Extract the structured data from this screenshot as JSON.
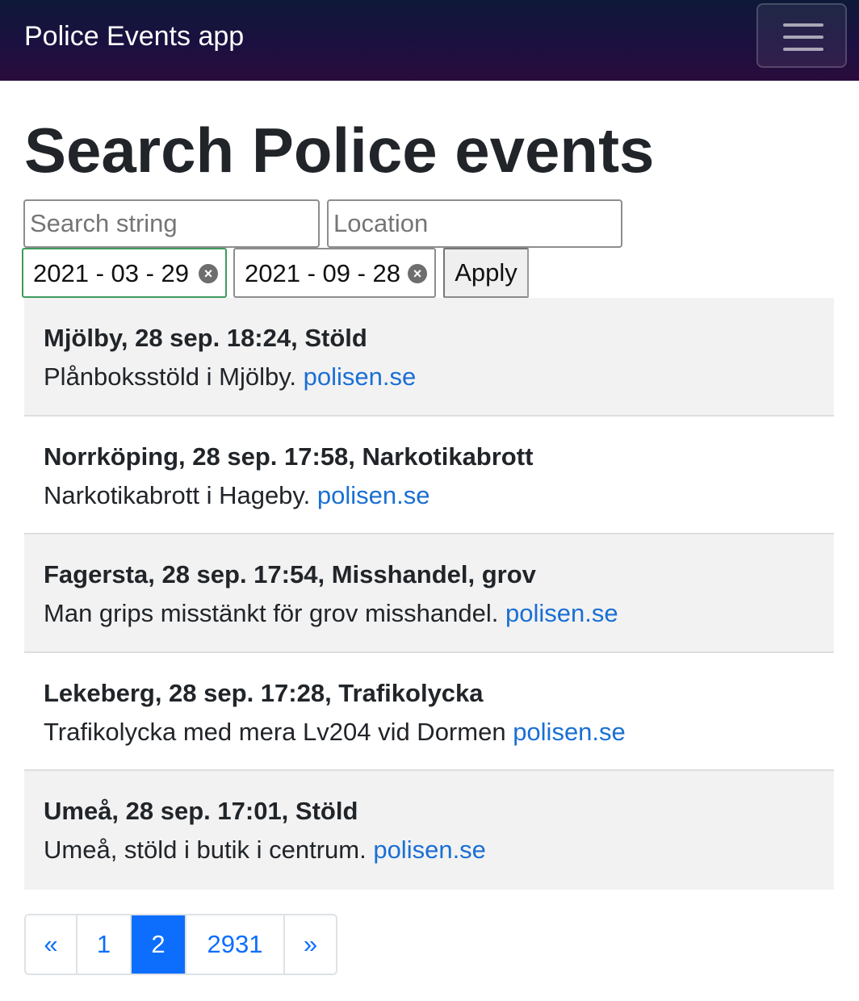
{
  "navbar": {
    "brand": "Police Events app",
    "toggler_icon": "hamburger-menu-icon"
  },
  "page": {
    "title": "Search Police events"
  },
  "filters": {
    "search_placeholder": "Search string",
    "search_value": "",
    "location_placeholder": "Location",
    "location_value": "",
    "date_from": "2021 - 03 - 29",
    "date_to": "2021 - 09 - 28",
    "clear_icon": "clear-circle-icon",
    "apply_label": "Apply"
  },
  "events": [
    {
      "title": "Mjölby, 28 sep. 18:24, Stöld",
      "description": "Plånboksstöld i Mjölby.",
      "link_text": "polisen.se"
    },
    {
      "title": "Norrköping, 28 sep. 17:58, Narkotikabrott",
      "description": "Narkotikabrott i Hageby.",
      "link_text": "polisen.se"
    },
    {
      "title": "Fagersta, 28 sep. 17:54, Misshandel, grov",
      "description": "Man grips misstänkt för grov misshandel.",
      "link_text": "polisen.se"
    },
    {
      "title": "Lekeberg, 28 sep. 17:28, Trafikolycka",
      "description": "Trafikolycka med mera Lv204 vid Dormen",
      "link_text": "polisen.se"
    },
    {
      "title": "Umeå, 28 sep. 17:01, Stöld",
      "description": "Umeå, stöld i butik i centrum.",
      "link_text": "polisen.se"
    }
  ],
  "pagination": {
    "prev": "«",
    "pages": [
      "1",
      "2",
      "2931"
    ],
    "current": "2",
    "next": "»"
  },
  "colors": {
    "link": "#1a6fd4",
    "active_page": "#0d6efd",
    "focused_border": "#3f9c5c"
  }
}
